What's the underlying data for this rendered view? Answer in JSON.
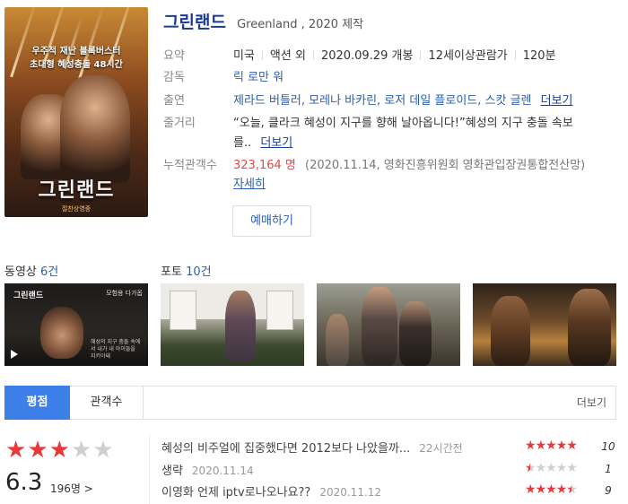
{
  "movie": {
    "title": "그린랜드",
    "subtitle": "Greenland , 2020 제작",
    "poster": {
      "tagline1": "우주적 재난 블록버스터",
      "tagline2": "초대형 혜성충돌 48시간",
      "logo": "그린랜드",
      "release": "절찬상영중"
    }
  },
  "info": {
    "summary_label": "요약",
    "summary_parts": [
      "미국",
      "액션 외",
      "2020.09.29 개봉",
      "12세이상관람가",
      "120분"
    ],
    "director_label": "감독",
    "director": "릭 로만 워",
    "cast_label": "출연",
    "cast": "제라드 버틀러, 모레나 바카린, 로저 데일 플로이드, 스캇 글렌",
    "cast_more": "더보기",
    "plot_label": "줄거리",
    "plot_line1": "“오늘, 클라크 혜성이 지구를 향해 날아옵니다!”혜성의 지구 충돌 속보",
    "plot_line2": "를..",
    "plot_more": "더보기",
    "audience_label": "누적관객수",
    "audience_count": "323,164 명",
    "audience_source": "(2020.11.14, 영화진흥위원회 영화관입장권통합전산망)",
    "audience_detail": "자세히"
  },
  "book_button": "예매하기",
  "media": {
    "video_label": "동영상",
    "video_count": "6건",
    "photo_label": "포토",
    "photo_count": "10건",
    "video_thumb_logo": "그린랜드",
    "video_thumb_badge": "모험용 다가옵",
    "video_thumb_caption": "혜성의 지구 충돌 속에서 내가 내 아이들을 지키야돼"
  },
  "tabs": {
    "rating": "평점",
    "audience": "관객수",
    "more": "더보기"
  },
  "rating": {
    "score": "6.3",
    "voters": "196명 >",
    "stars_value": 3
  },
  "reviews": [
    {
      "text": "혜성의 비주얼에 집중했다면 2012보다 나았을까...",
      "date": "22시간전",
      "score": "10",
      "stars": 5
    },
    {
      "text": "생략",
      "date": "2020.11.14",
      "score": "1",
      "stars": 0.5
    },
    {
      "text": "이영화 언제 iptv로나오나요??",
      "date": "2020.11.12",
      "score": "9",
      "stars": 4.5
    }
  ],
  "colors": {
    "title": "#1a3a9c",
    "link": "#2a5db0",
    "accent_red": "#e8393a",
    "tab_active": "#3d7fe8"
  }
}
